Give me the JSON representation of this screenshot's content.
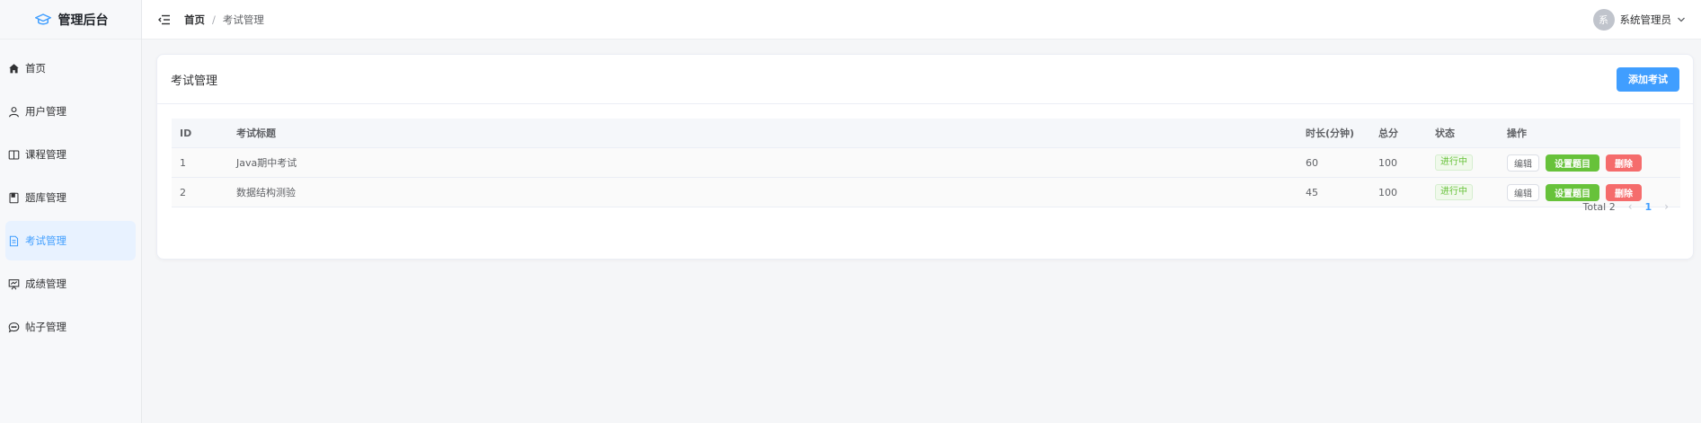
{
  "brand": {
    "title": "管理后台",
    "icon": "graduation-cap-icon"
  },
  "sidebar": {
    "items": [
      {
        "label": "首页",
        "icon": "home-icon",
        "active": false
      },
      {
        "label": "用户管理",
        "icon": "user-icon",
        "active": false
      },
      {
        "label": "课程管理",
        "icon": "book-icon",
        "active": false
      },
      {
        "label": "题库管理",
        "icon": "notebook-icon",
        "active": false
      },
      {
        "label": "考试管理",
        "icon": "document-icon",
        "active": true
      },
      {
        "label": "成绩管理",
        "icon": "presentation-icon",
        "active": false
      },
      {
        "label": "帖子管理",
        "icon": "chat-icon",
        "active": false
      }
    ]
  },
  "header": {
    "breadcrumb": {
      "home": "首页",
      "separator": "/",
      "current": "考试管理"
    },
    "user": {
      "avatar_text": "系",
      "name": "系统管理员"
    }
  },
  "card": {
    "title": "考试管理",
    "add_button": "添加考试"
  },
  "table": {
    "columns": [
      "ID",
      "考试标题",
      "时长(分钟)",
      "总分",
      "状态",
      "操作"
    ],
    "rows": [
      {
        "id": "1",
        "title": "Java期中考试",
        "duration": "60",
        "score": "100",
        "status": "进行中"
      },
      {
        "id": "2",
        "title": "数据结构测验",
        "duration": "45",
        "score": "100",
        "status": "进行中"
      }
    ],
    "actions": {
      "edit": "编辑",
      "set_questions": "设置题目",
      "delete": "删除"
    }
  },
  "pagination": {
    "total": "Total 2",
    "current_page": "1"
  },
  "colors": {
    "primary": "#409eff",
    "success": "#67c23a",
    "danger": "#f56c6c"
  }
}
